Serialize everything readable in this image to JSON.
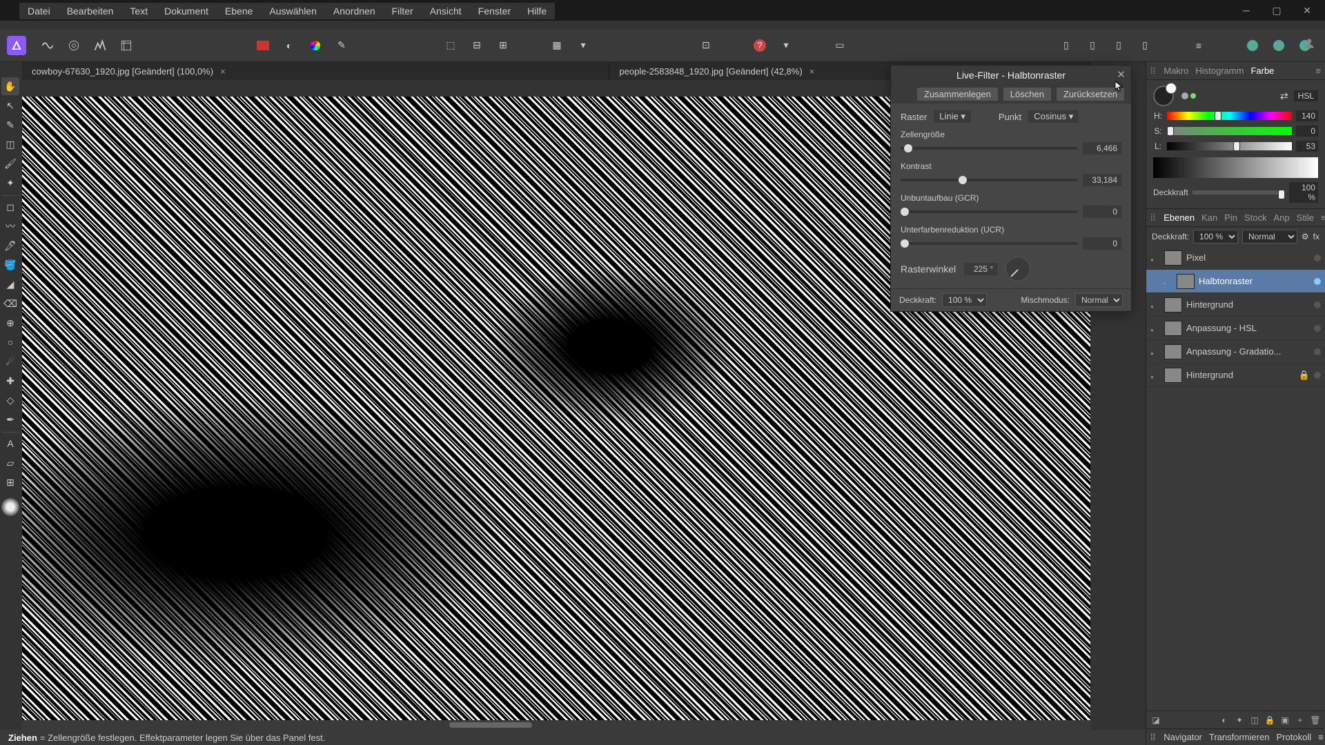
{
  "menu": [
    "Datei",
    "Bearbeiten",
    "Text",
    "Dokument",
    "Ebene",
    "Auswählen",
    "Anordnen",
    "Filter",
    "Ansicht",
    "Fenster",
    "Hilfe"
  ],
  "tabs": [
    {
      "name": "cowboy-67630_1920.jpg [Geändert] (100,0%)"
    },
    {
      "name": "people-2583848_1920.jpg [Geändert] (42,8%)"
    }
  ],
  "dialog": {
    "title": "Live-Filter - Halbtonraster",
    "btn_merge": "Zusammenlegen",
    "btn_delete": "Löschen",
    "btn_reset": "Zurücksetzen",
    "raster_label": "Raster",
    "raster_value": "Linie",
    "punkt_label": "Punkt",
    "punkt_value": "Cosinus",
    "cellsize_label": "Zellengröße",
    "cellsize_value": "6,466",
    "contrast_label": "Kontrast",
    "contrast_value": "33,184",
    "gcr_label": "Unbuntaufbau (GCR)",
    "gcr_value": "0",
    "ucr_label": "Unterfarbenreduktion (UCR)",
    "ucr_value": "0",
    "angle_label": "Rasterwinkel",
    "angle_value": "225 °",
    "opacity_label": "Deckkraft:",
    "opacity_value": "100 %",
    "blend_label": "Mischmodus:",
    "blend_value": "Normal"
  },
  "rp_tabs1": [
    "Makro",
    "Histogramm",
    "Farbe"
  ],
  "color": {
    "mode": "HSL",
    "h_label": "H:",
    "h_val": "140",
    "s_label": "S:",
    "s_val": "0",
    "l_label": "L:",
    "l_val": "53",
    "opacity_label": "Deckkraft",
    "opacity_val": "100 %"
  },
  "rp_tabs2": [
    "Ebenen",
    "Kan",
    "Pin",
    "Stock",
    "Anp",
    "Stile"
  ],
  "layers_header": {
    "opacity_label": "Deckkraft:",
    "opacity_val": "100 %",
    "blend": "Normal"
  },
  "layers": [
    {
      "name": "Pixel",
      "sel": false,
      "child": false,
      "locked": false
    },
    {
      "name": "Halbtonraster",
      "sel": true,
      "child": true,
      "locked": false
    },
    {
      "name": "Hintergrund",
      "sel": false,
      "child": false,
      "locked": false
    },
    {
      "name": "Anpassung - HSL",
      "sel": false,
      "child": false,
      "locked": false
    },
    {
      "name": "Anpassung - Gradatio...",
      "sel": false,
      "child": false,
      "locked": false
    },
    {
      "name": "Hintergrund",
      "sel": false,
      "child": false,
      "locked": true
    }
  ],
  "bottom_tabs": [
    "Navigator",
    "Transformieren",
    "Protokoll"
  ],
  "status": {
    "prefix": "Ziehen",
    "text": " = Zellengröße festlegen. Effektparameter legen Sie über das Panel fest."
  }
}
